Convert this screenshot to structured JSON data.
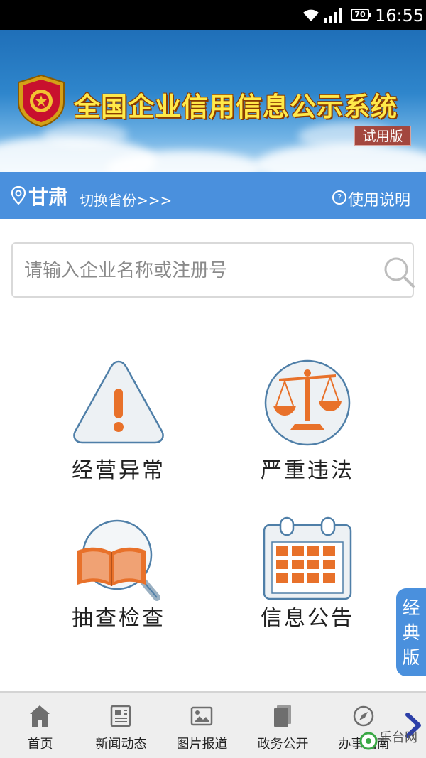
{
  "status_bar": {
    "battery": "70",
    "time": "16:55"
  },
  "banner": {
    "title": "全国企业信用信息公示系统",
    "badge": "试用版"
  },
  "province_bar": {
    "province": "甘肃",
    "switch_label": "切换省份>>>",
    "help_label": "使用说明"
  },
  "search": {
    "placeholder": "请输入企业名称或注册号"
  },
  "tiles": [
    {
      "label": "经营异常",
      "icon": "warning-icon"
    },
    {
      "label": "严重违法",
      "icon": "scales-icon"
    },
    {
      "label": "抽查检查",
      "icon": "book-search-icon"
    },
    {
      "label": "信息公告",
      "icon": "calendar-icon"
    }
  ],
  "classic_tab": {
    "label": "经典版"
  },
  "bottom_nav": [
    {
      "label": "首页",
      "icon": "home-icon"
    },
    {
      "label": "新闻动态",
      "icon": "news-icon"
    },
    {
      "label": "图片报道",
      "icon": "image-icon"
    },
    {
      "label": "政务公开",
      "icon": "document-icon"
    },
    {
      "label": "办事指南",
      "icon": "compass-icon"
    }
  ],
  "watermark": {
    "text": "乐台网"
  },
  "colors": {
    "accent_blue": "#4a90dd",
    "icon_orange": "#e8712a",
    "icon_outline": "#4f7fa8"
  }
}
